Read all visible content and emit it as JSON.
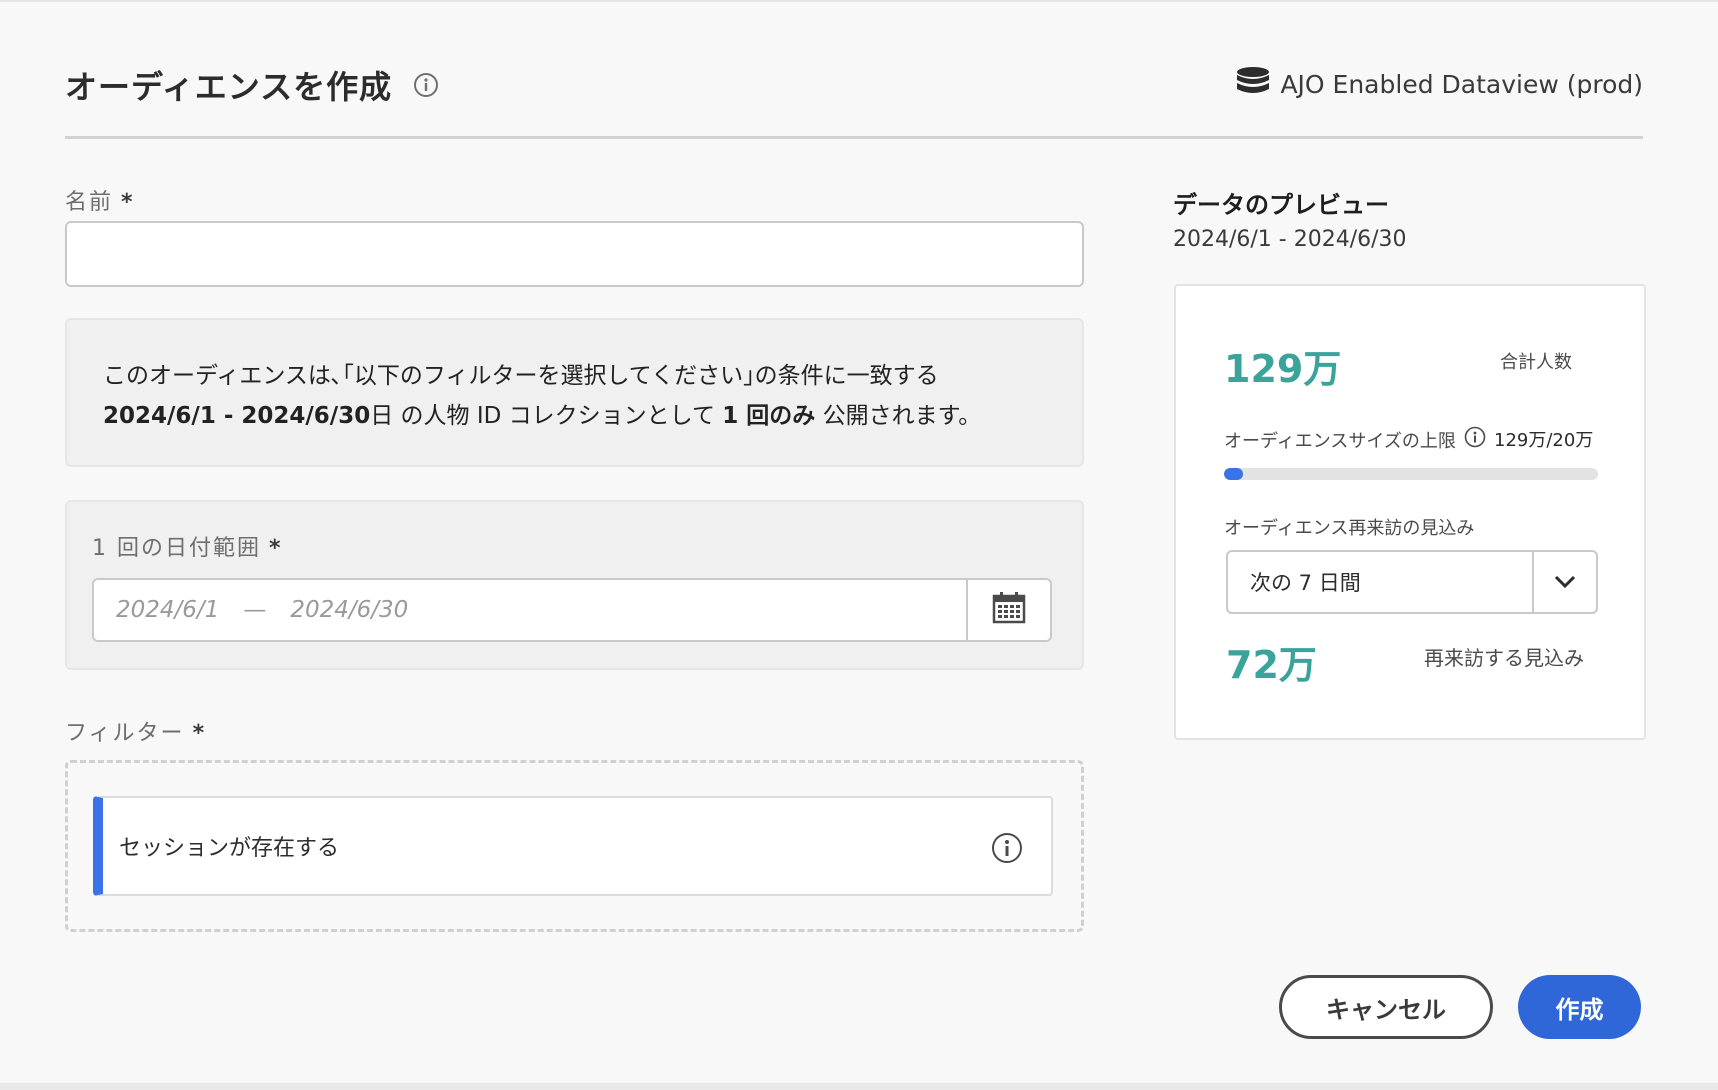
{
  "header": {
    "title": "オーディエンスを作成",
    "dataview": "AJO Enabled Dataview (prod)"
  },
  "name_field": {
    "label": "名前",
    "required": "*",
    "value": "",
    "placeholder": ""
  },
  "summary": {
    "line1": "このオーディエンスは､｢以下のフィルターを選択してください｣の条件に一致する",
    "date_range": "2024/6/1 - 2024/6/30",
    "line2_a": "日 の人物 ID コレクションとして",
    "frequency": "1 回のみ",
    "line2_b": "公開されます。"
  },
  "date_range": {
    "label": "1 回の日付範囲",
    "required": "*",
    "start": "2024/6/1",
    "separator": "—",
    "end": "2024/6/30"
  },
  "filter": {
    "label": "フィルター",
    "required": "*",
    "item": "セッションが存在する"
  },
  "preview": {
    "title": "データのプレビュー",
    "range": "2024/6/1 - 2024/6/30",
    "total_value": "129万",
    "total_label": "合計人数",
    "limit_label": "オーディエンスサイズの上限",
    "limit_value": "129万/20万",
    "limit_fraction": 0.05,
    "return_label": "オーディエンス再来訪の見込み",
    "return_select": "次の 7 日間",
    "return_value": "72万",
    "return_value_label": "再来訪する見込み"
  },
  "buttons": {
    "cancel": "キャンセル",
    "create": "作成"
  },
  "colors": {
    "accent": "#3a72e8",
    "primary_button": "#2f67d8",
    "metric": "#3aa39a"
  }
}
